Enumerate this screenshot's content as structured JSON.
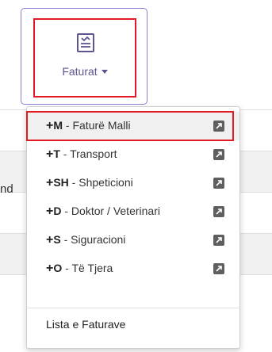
{
  "toolbar": {
    "invoices_label": "Faturat",
    "icon": "invoice-icon"
  },
  "background": {
    "partial_text": "nd"
  },
  "menu": {
    "items": [
      {
        "plus": "+",
        "code": "M",
        "sep": " - ",
        "name": "Faturë Malli",
        "icon": "external-link-icon"
      },
      {
        "plus": "+",
        "code": "T",
        "sep": " - ",
        "name": "Transport",
        "icon": "external-link-icon"
      },
      {
        "plus": "+",
        "code": "SH",
        "sep": " - ",
        "name": "Shpeticioni",
        "icon": "external-link-icon"
      },
      {
        "plus": "+",
        "code": "D",
        "sep": " - ",
        "name": "Doktor / Veterinari",
        "icon": "external-link-icon"
      },
      {
        "plus": "+",
        "code": "S",
        "sep": " - ",
        "name": "Siguracioni",
        "icon": "external-link-icon"
      },
      {
        "plus": "+",
        "code": "O",
        "sep": " - ",
        "name": "Të Tjera",
        "icon": "external-link-icon"
      }
    ],
    "footer_label": "Lista e Faturave"
  },
  "colors": {
    "highlight": "#e21b23",
    "accent": "#5b5590"
  }
}
